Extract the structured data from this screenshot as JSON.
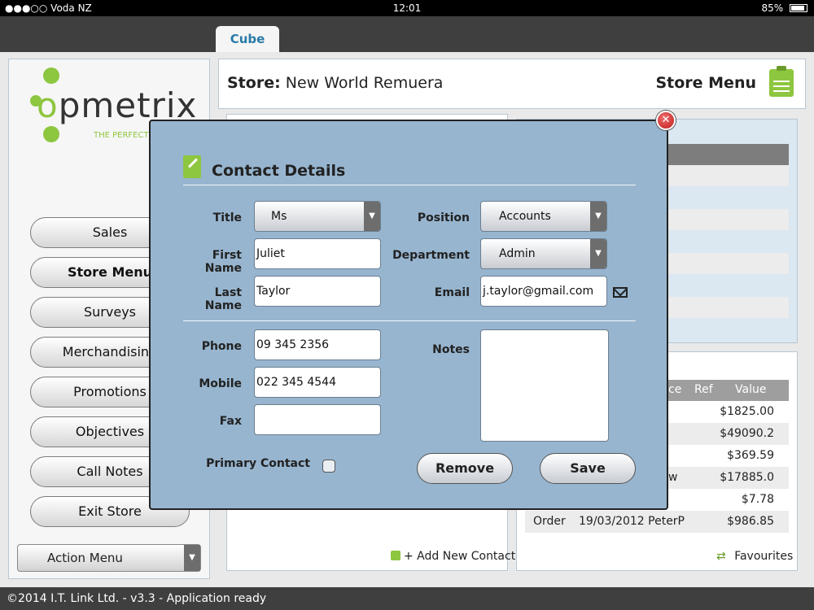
{
  "status_bar": {
    "carrier": "●●●○○ Voda NZ",
    "time": "12:01",
    "battery": "85%"
  },
  "tabs": [
    {
      "label": "Cube"
    }
  ],
  "logo": {
    "text": "pmetrix",
    "tagline": "THE PERFECT S"
  },
  "sidebar": {
    "items": [
      {
        "label": "Sales"
      },
      {
        "label": "Store Menu"
      },
      {
        "label": "Surveys"
      },
      {
        "label": "Merchandising"
      },
      {
        "label": "Promotions"
      },
      {
        "label": "Objectives"
      },
      {
        "label": "Call Notes"
      },
      {
        "label": "Exit Store"
      }
    ],
    "action_menu": "Action Menu"
  },
  "header": {
    "store_prefix": "Store:",
    "store_name": "New World Remuera",
    "menu_label": "Store Menu"
  },
  "orders_table": {
    "headers": [
      "ce",
      "Ref",
      "Value"
    ],
    "rows": [
      {
        "type": "",
        "date": "",
        "value": "$1825.00"
      },
      {
        "type": "",
        "date": "",
        "value": "$49090.2"
      },
      {
        "type": "",
        "date": "",
        "value": "$369.59"
      },
      {
        "type": "w",
        "date": "",
        "value": "$17885.0"
      },
      {
        "type": "",
        "date": "",
        "value": "$7.78"
      },
      {
        "type": "Order",
        "date": "19/03/2012 PeterP",
        "value": "$986.85"
      }
    ]
  },
  "links": {
    "add_contact": "+ Add New Contact",
    "favourites": "Favourites"
  },
  "footer": {
    "text": "©2014 I.T. Link Ltd. - v3.3 - Application ready"
  },
  "modal": {
    "title": "Contact Details",
    "labels": {
      "title": "Title",
      "first_name": "First Name",
      "last_name": "Last Name",
      "position": "Position",
      "department": "Department",
      "email": "Email",
      "phone": "Phone",
      "mobile": "Mobile",
      "fax": "Fax",
      "notes": "Notes",
      "primary_contact": "Primary Contact"
    },
    "values": {
      "title": "Ms",
      "first_name": "Juliet",
      "last_name": "Taylor",
      "position": "Accounts",
      "department": "Admin",
      "email": "j.taylor@gmail.com",
      "phone": "09 345 2356",
      "mobile": "022 345 4544",
      "fax": "",
      "notes": ""
    },
    "buttons": {
      "remove": "Remove",
      "save": "Save"
    },
    "close_glyph": "✕"
  },
  "colors": {
    "accent_green": "#8dc63f",
    "modal_bg": "#97b5cf",
    "tab_text": "#2a7aa8"
  }
}
